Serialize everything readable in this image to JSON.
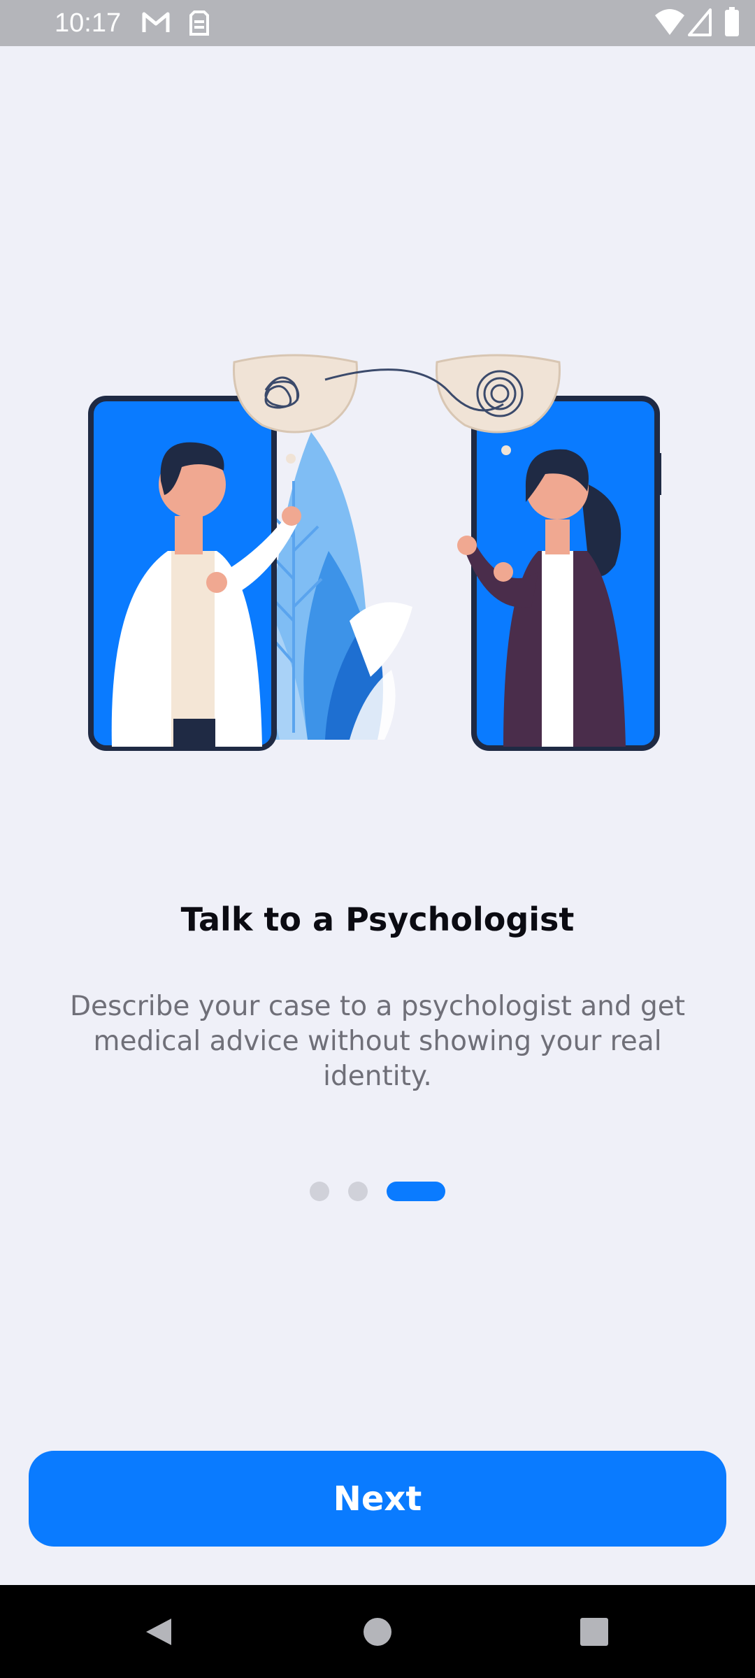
{
  "status_bar": {
    "time": "10:17",
    "icons": [
      "gmail-icon",
      "sim-card-icon",
      "wifi-icon",
      "cellular-signal-icon",
      "battery-icon"
    ]
  },
  "illustration": {
    "icon": "psychologist-consultation-illustration",
    "colors": {
      "phone": "#0a7bff",
      "phone_frame": "#1f2a44",
      "thought_bubble": "#f0e3d6",
      "coat": "#ffffff",
      "jacket": "#4a2d4b"
    }
  },
  "onboarding": {
    "title": "Talk to a Psychologist",
    "description": "Describe your case to a psychologist and get medical advice without showing your real identity.",
    "page_count": 3,
    "current_page": 3
  },
  "actions": {
    "next_label": "Next"
  },
  "navigation": {
    "icons": [
      "back-icon",
      "home-icon",
      "recents-icon"
    ]
  },
  "colors": {
    "accent": "#0a7bff",
    "background": "#eff0f8",
    "inactive_dot": "#d0d1d9"
  }
}
